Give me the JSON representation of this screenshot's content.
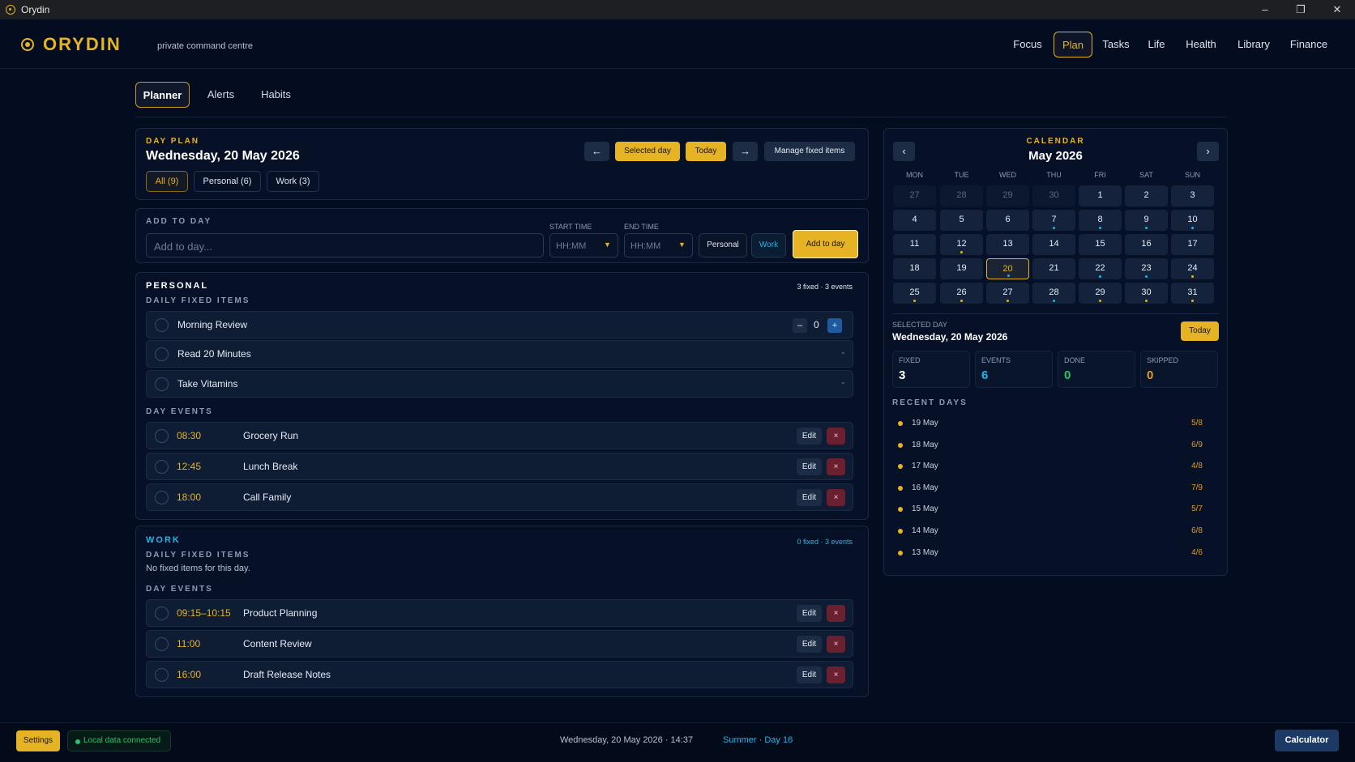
{
  "window": {
    "title": "Orydin",
    "min": "–",
    "max": "❐",
    "close": "✕"
  },
  "brand": {
    "name": "ORYDIN",
    "tagline": "private command centre"
  },
  "nav": [
    "Focus",
    "Plan",
    "Tasks",
    "Life",
    "Health",
    "Library",
    "Finance"
  ],
  "subtabs": [
    "Planner",
    "Alerts",
    "Habits"
  ],
  "dayplan": {
    "label": "DAY PLAN",
    "date": "Wednesday, 20 May 2026",
    "prev": "←",
    "selected": "Selected day",
    "today": "Today",
    "next": "→",
    "manage": "Manage fixed items",
    "filters": [
      "All (9)",
      "Personal (6)",
      "Work (3)"
    ]
  },
  "add": {
    "label": "ADD TO DAY",
    "placeholder": "Add to day...",
    "start_label": "START TIME",
    "end_label": "END TIME",
    "start_ph": "HH:MM",
    "end_ph": "HH:MM",
    "personal": "Personal",
    "work": "Work",
    "button": "Add to day"
  },
  "personal": {
    "title": "PERSONAL",
    "summary": "3 fixed · 3 events",
    "fixed_label": "DAILY FIXED ITEMS",
    "fixed": [
      {
        "name": "Morning Review",
        "count": "0"
      },
      {
        "name": "Read 20 Minutes",
        "dash": "-"
      },
      {
        "name": "Take Vitamins",
        "dash": "-"
      }
    ],
    "events_label": "DAY EVENTS",
    "events": [
      {
        "time": "08:30",
        "name": "Grocery Run"
      },
      {
        "time": "12:45",
        "name": "Lunch Break"
      },
      {
        "time": "18:00",
        "name": "Call Family"
      }
    ]
  },
  "work": {
    "title": "WORK",
    "summary": "0 fixed · 3 events",
    "fixed_label": "DAILY FIXED ITEMS",
    "empty": "No fixed items for this day.",
    "events_label": "DAY EVENTS",
    "events": [
      {
        "time": "09:15–10:15",
        "name": "Product Planning"
      },
      {
        "time": "11:00",
        "name": "Content Review"
      },
      {
        "time": "16:00",
        "name": "Draft Release Notes"
      }
    ]
  },
  "row_actions": {
    "edit": "Edit",
    "delete": "×",
    "minus": "–",
    "plus": "+"
  },
  "calendar": {
    "label": "CALENDAR",
    "month": "May 2026",
    "prev": "‹",
    "next": "›",
    "dow": [
      "MON",
      "TUE",
      "WED",
      "THU",
      "FRI",
      "SAT",
      "SUN"
    ],
    "weeks": [
      [
        {
          "d": "27",
          "m": true
        },
        {
          "d": "28",
          "m": true
        },
        {
          "d": "29",
          "m": true
        },
        {
          "d": "30",
          "m": true
        },
        {
          "d": "1"
        },
        {
          "d": "2"
        },
        {
          "d": "3"
        }
      ],
      [
        {
          "d": "4"
        },
        {
          "d": "5"
        },
        {
          "d": "6"
        },
        {
          "d": "7",
          "dot": "cyan"
        },
        {
          "d": "8",
          "dot": "cyan"
        },
        {
          "d": "9",
          "dot": "cyan"
        },
        {
          "d": "10",
          "dot": "cyan"
        }
      ],
      [
        {
          "d": "11"
        },
        {
          "d": "12",
          "dot": "gold"
        },
        {
          "d": "13"
        },
        {
          "d": "14"
        },
        {
          "d": "15"
        },
        {
          "d": "16"
        },
        {
          "d": "17"
        }
      ],
      [
        {
          "d": "18"
        },
        {
          "d": "19"
        },
        {
          "d": "20",
          "sel": true,
          "dot": "cyan"
        },
        {
          "d": "21"
        },
        {
          "d": "22",
          "dot": "cyan"
        },
        {
          "d": "23",
          "dot": "cyan"
        },
        {
          "d": "24",
          "dot": "gold"
        }
      ],
      [
        {
          "d": "25",
          "dot": "gold"
        },
        {
          "d": "26",
          "dot": "gold"
        },
        {
          "d": "27",
          "dot": "gold"
        },
        {
          "d": "28",
          "dot": "cyan"
        },
        {
          "d": "29",
          "dot": "gold"
        },
        {
          "d": "30",
          "dot": "gold"
        },
        {
          "d": "31",
          "dot": "gold"
        }
      ]
    ]
  },
  "selected": {
    "label": "SELECTED DAY",
    "date": "Wednesday, 20 May 2026",
    "today": "Today",
    "stats": [
      {
        "label": "FIXED",
        "value": "3",
        "color": "#ffffff"
      },
      {
        "label": "EVENTS",
        "value": "6",
        "color": "#26b3e6"
      },
      {
        "label": "DONE",
        "value": "0",
        "color": "#2bc26b"
      },
      {
        "label": "SKIPPED",
        "value": "0",
        "color": "#e69a25"
      }
    ]
  },
  "recent": {
    "label": "RECENT DAYS",
    "days": [
      {
        "date": "19 May",
        "score": "5/8"
      },
      {
        "date": "18 May",
        "score": "6/9"
      },
      {
        "date": "17 May",
        "score": "4/8"
      },
      {
        "date": "16 May",
        "score": "7/9"
      },
      {
        "date": "15 May",
        "score": "5/7"
      },
      {
        "date": "14 May",
        "score": "6/8"
      },
      {
        "date": "13 May",
        "score": "4/6"
      }
    ]
  },
  "footer": {
    "settings": "Settings",
    "status": "Local data connected",
    "datetime": "Wednesday, 20 May 2026 · 14:37",
    "season": "Summer · Day 16",
    "calculator": "Calculator"
  },
  "colors": {
    "gold": "#e6b325",
    "cyan": "#26b3e6",
    "green": "#2bc26b",
    "orange": "#e69a25",
    "bg": "#040d1f"
  }
}
